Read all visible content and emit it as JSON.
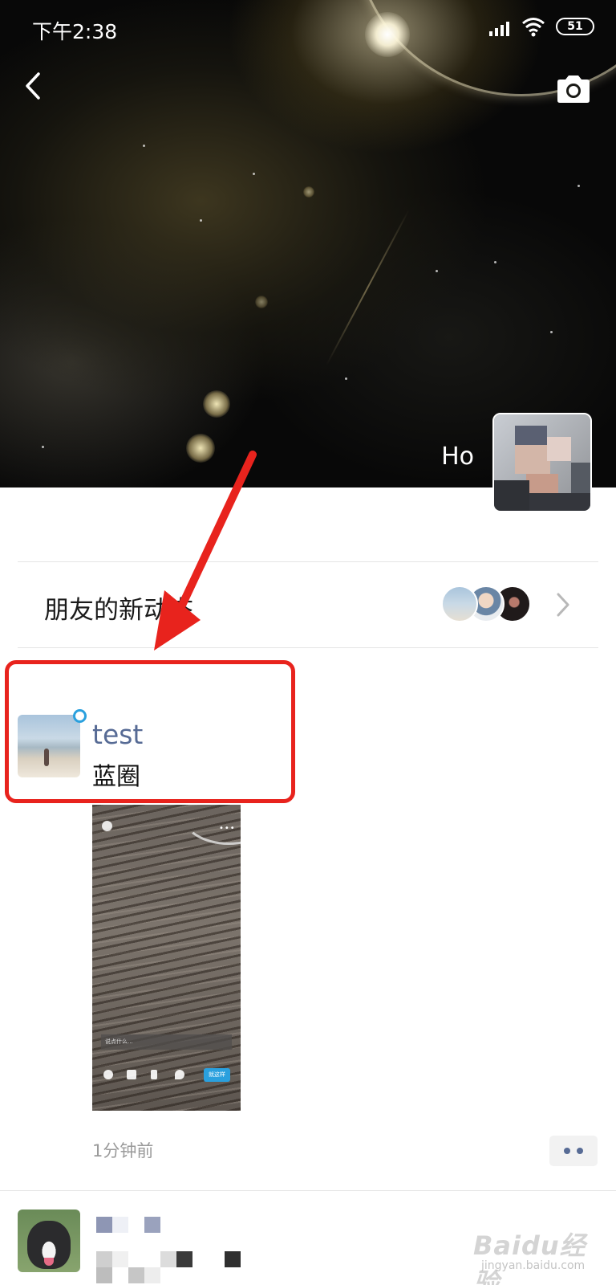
{
  "status_bar": {
    "time": "下午2:38",
    "battery": "51",
    "icons": [
      "signal-icon",
      "wifi-icon",
      "battery-icon"
    ]
  },
  "header": {
    "back_icon": "chevron-left-icon",
    "camera_icon": "camera-icon",
    "profile_name": "Ho"
  },
  "friends_updates": {
    "label": "朋友的新动态",
    "chevron_icon": "chevron-right-icon"
  },
  "post": {
    "username": "test",
    "text": "蓝圈",
    "time": "1分钟前",
    "status_icon": "status-ring-icon",
    "image": {
      "input_placeholder": "说点什么...",
      "send_label": "就这样"
    },
    "more_icon": "more-dots-icon"
  },
  "watermark": {
    "brand": "Baidu经验",
    "url": "jingyan.baidu.com"
  },
  "colors": {
    "link_blue": "#576b95",
    "accent_blue": "#2aa0de",
    "annotation_red": "#e8231d"
  }
}
